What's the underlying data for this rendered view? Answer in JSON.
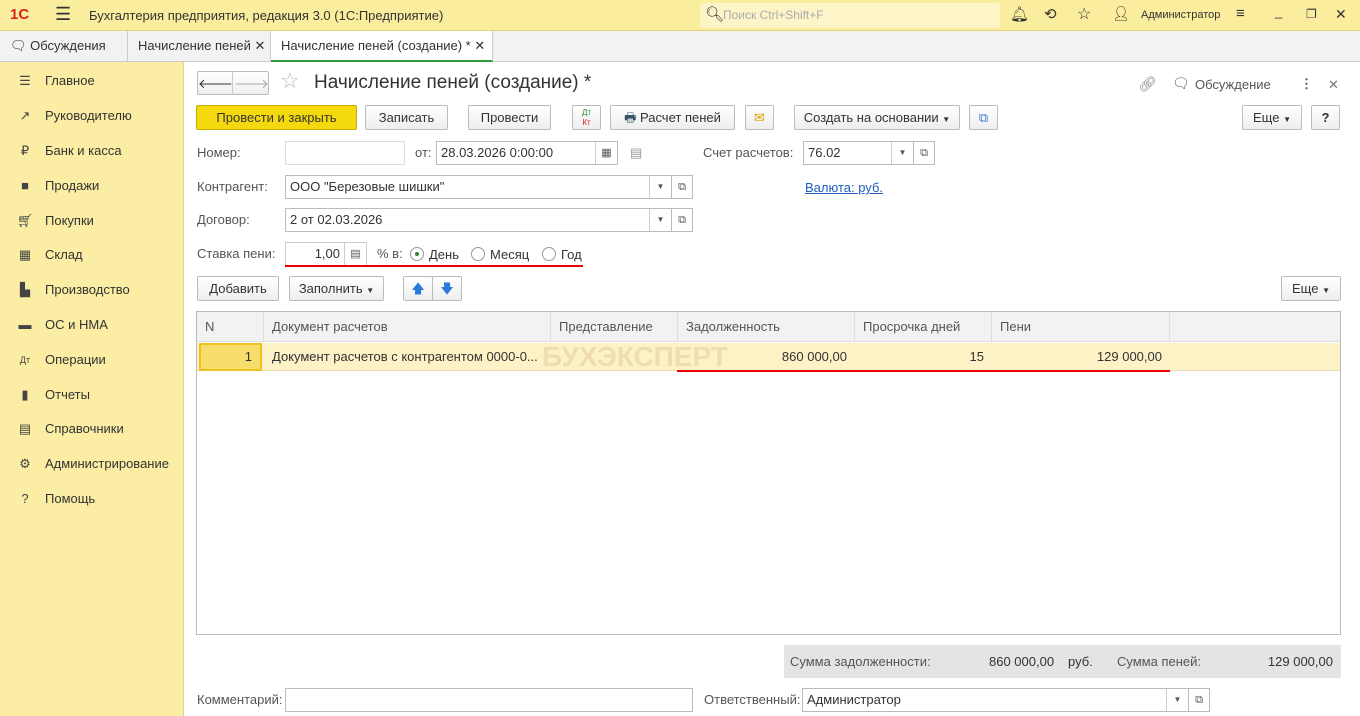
{
  "app": {
    "title": "Бухгалтерия предприятия, редакция 3.0  (1С:Предприятие)",
    "search_placeholder": "Поиск Ctrl+Shift+F",
    "user": "Администратор"
  },
  "tabs": [
    {
      "label": "Обсуждения"
    },
    {
      "label": "Начисление пеней"
    },
    {
      "label": "Начисление пеней (создание) *"
    }
  ],
  "sidebar": {
    "items": [
      {
        "label": "Главное",
        "icon": "menu-icon"
      },
      {
        "label": "Руководителю",
        "icon": "trend-icon"
      },
      {
        "label": "Банк и касса",
        "icon": "ruble-icon"
      },
      {
        "label": "Продажи",
        "icon": "bag-icon"
      },
      {
        "label": "Покупки",
        "icon": "cart-icon"
      },
      {
        "label": "Склад",
        "icon": "grid-icon"
      },
      {
        "label": "Производство",
        "icon": "factory-icon"
      },
      {
        "label": "ОС и НМА",
        "icon": "car-icon"
      },
      {
        "label": "Операции",
        "icon": "dtkt-icon"
      },
      {
        "label": "Отчеты",
        "icon": "chart-icon"
      },
      {
        "label": "Справочники",
        "icon": "book-icon"
      },
      {
        "label": "Администрирование",
        "icon": "gear-icon"
      },
      {
        "label": "Помощь",
        "icon": "question-icon"
      }
    ]
  },
  "form": {
    "title": "Начисление пеней (создание) *",
    "discussion": "Обсуждение",
    "toolbar": {
      "post_close": "Провести и закрыть",
      "save": "Записать",
      "post": "Провести",
      "dtkt_top": "Дт",
      "dtkt_bottom": "Кт",
      "calc": "Расчет пеней",
      "create_based": "Создать на основании",
      "more": "Еще",
      "help": "?"
    },
    "number_label": "Номер:",
    "number_value": "",
    "date_label": "от:",
    "date_value": "28.03.2026  0:00:00",
    "account_label": "Счет расчетов:",
    "account_value": "76.02",
    "counterparty_label": "Контрагент:",
    "counterparty_value": "ООО \"Березовые шишки\"",
    "currency_link": "Валюта: руб.",
    "contract_label": "Договор:",
    "contract_value": "2 от 02.03.2026",
    "rate_label": "Ставка пени:",
    "rate_value": "1,00",
    "rate_unit": "% в:",
    "period_options": [
      {
        "label": "День",
        "selected": true
      },
      {
        "label": "Месяц",
        "selected": false
      },
      {
        "label": "Год",
        "selected": false
      }
    ],
    "table_toolbar": {
      "add": "Добавить",
      "fill": "Заполнить",
      "more": "Еще"
    },
    "table": {
      "columns": [
        "N",
        "Документ расчетов",
        "Представление",
        "Задолженность",
        "Просрочка дней",
        "Пени"
      ],
      "rows": [
        {
          "n": "1",
          "doc": "Документ расчетов с контрагентом 0000-0...",
          "repr": "",
          "debt": "860 000,00",
          "days": "15",
          "penalty": "129 000,00"
        }
      ]
    },
    "watermark": "БУХЭКСПЕРТ",
    "totals": {
      "debt_label": "Сумма задолженности:",
      "debt_value": "860 000,00",
      "currency": "руб.",
      "penalty_label": "Сумма пеней:",
      "penalty_value": "129 000,00"
    },
    "comment_label": "Комментарий:",
    "comment_value": "",
    "responsible_label": "Ответственный:",
    "responsible_value": "Администратор"
  }
}
